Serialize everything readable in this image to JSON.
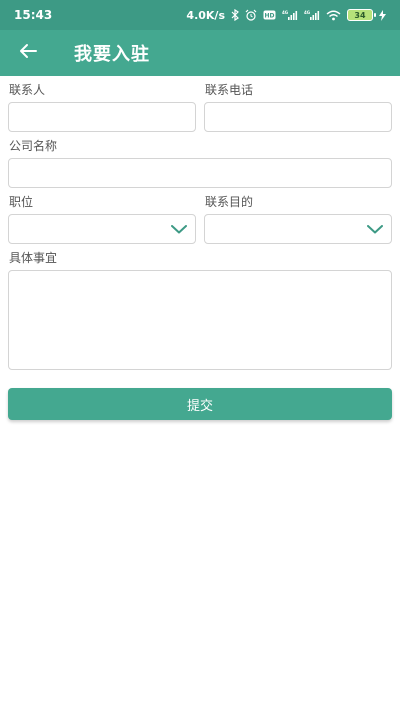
{
  "status_bar": {
    "time": "15:43",
    "net_speed": "4.0K/s",
    "battery": "34",
    "icons": [
      "bluetooth-icon",
      "alarm-icon",
      "hd-icon",
      "signal-4g-icon",
      "signal-4g-icon",
      "wifi-icon",
      "battery-icon",
      "charging-icon"
    ]
  },
  "toolbar": {
    "back_icon": "arrow-left-icon",
    "title": "我要入驻"
  },
  "form": {
    "contact_person_label": "联系人",
    "contact_person_value": "",
    "contact_phone_label": "联系电话",
    "contact_phone_value": "",
    "company_name_label": "公司名称",
    "company_name_value": "",
    "position_label": "职位",
    "position_value": "",
    "purpose_label": "联系目的",
    "purpose_value": "",
    "details_label": "具体事宜",
    "details_value": "",
    "submit_label": "提交"
  },
  "colors": {
    "status_bar": "#3d9a85",
    "primary": "#44a890"
  }
}
